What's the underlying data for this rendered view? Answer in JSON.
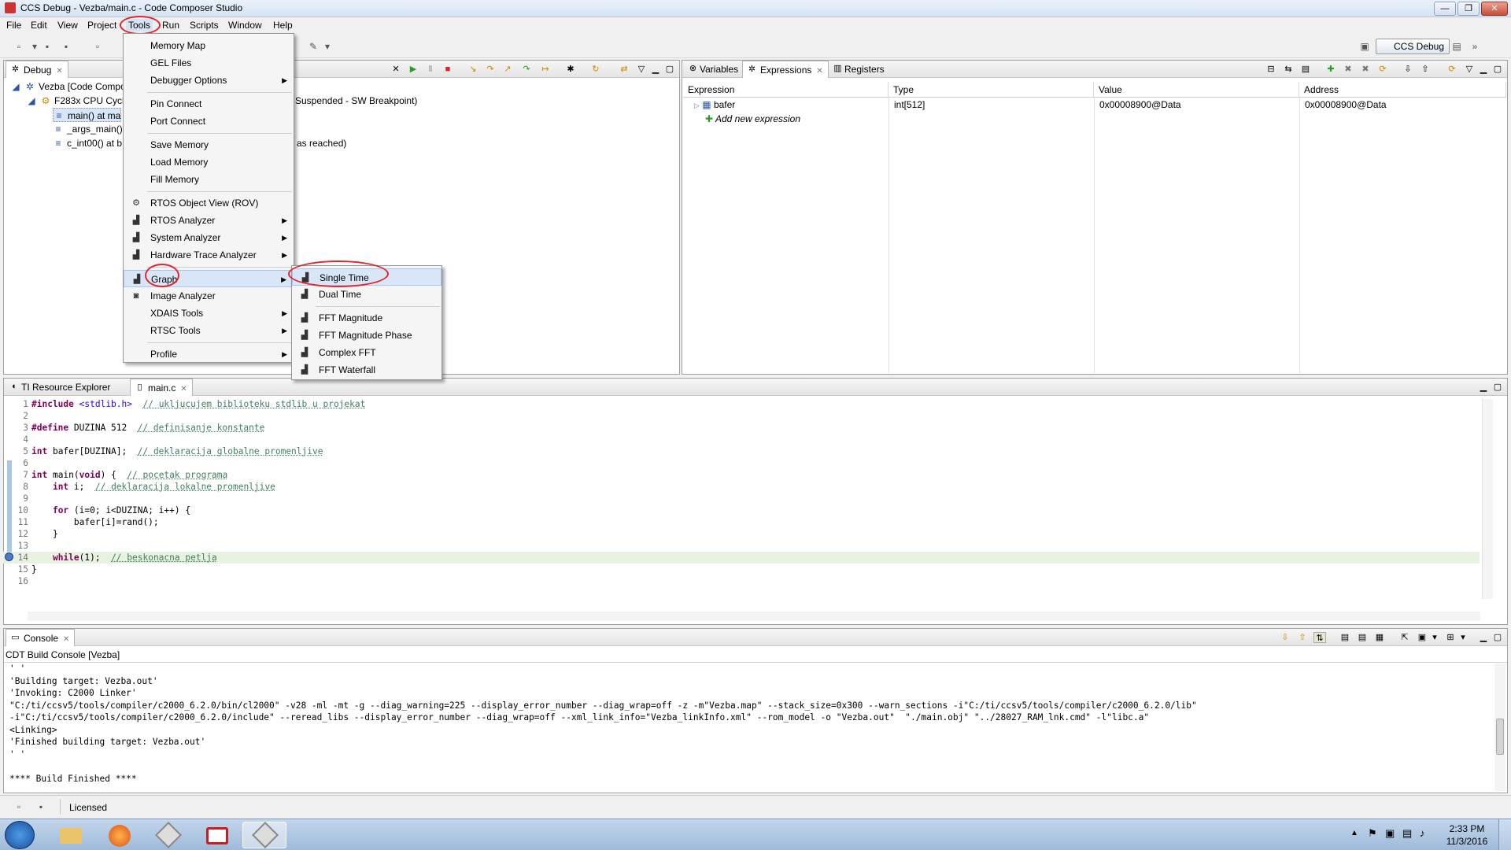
{
  "window": {
    "title": "CCS Debug - Vezba/main.c - Code Composer Studio",
    "controls": [
      "—",
      "❐",
      "✕"
    ]
  },
  "menubar": [
    "File",
    "Edit",
    "View",
    "Project",
    "Tools",
    "Run",
    "Scripts",
    "Window",
    "Help"
  ],
  "toolbar": {
    "perspective_label": "CCS Debug"
  },
  "debug_panel": {
    "tab_label": "Debug",
    "tree": [
      "Vezba [Code Compo",
      "F283x CPU Cycle",
      "main() at ma",
      "_args_main()",
      "c_int00() at b"
    ],
    "partial_texts": [
      "Suspended - SW Breakpoint)",
      "as reached)"
    ]
  },
  "variables_panel": {
    "tabs": [
      "Variables",
      "Expressions",
      "Registers"
    ],
    "columns": [
      "Expression",
      "Type",
      "Value",
      "Address"
    ],
    "rows": [
      {
        "expression": "bafer",
        "type": "int[512]",
        "value": "0x00008900@Data",
        "address": "0x00008900@Data"
      }
    ],
    "add_label": "Add new expression"
  },
  "editor": {
    "tabs": [
      "TI Resource Explorer",
      "main.c"
    ],
    "lines": [
      {
        "n": "1",
        "code": "#include <stdlib.h>  // ukljucujem biblioteku stdlib u projekat"
      },
      {
        "n": "2",
        "code": ""
      },
      {
        "n": "3",
        "code": "#define DUZINA 512  // definisanje konstante"
      },
      {
        "n": "4",
        "code": ""
      },
      {
        "n": "5",
        "code": "int bafer[DUZINA];  // deklaracija globalne promenljive"
      },
      {
        "n": "6",
        "code": ""
      },
      {
        "n": "7",
        "code": "int main(void) {  // pocetak programa"
      },
      {
        "n": "8",
        "code": "    int i;  // deklaracija lokalne promenljive"
      },
      {
        "n": "9",
        "code": ""
      },
      {
        "n": "10",
        "code": "    for (i=0; i<DUZINA; i++) {"
      },
      {
        "n": "11",
        "code": "        bafer[i]=rand();"
      },
      {
        "n": "12",
        "code": "    }"
      },
      {
        "n": "13",
        "code": ""
      },
      {
        "n": "14",
        "code": "    while(1);  // beskonacna petlja"
      },
      {
        "n": "15",
        "code": "}"
      },
      {
        "n": "16",
        "code": ""
      }
    ]
  },
  "console": {
    "tab_label": "Console",
    "subtitle": "CDT Build Console [Vezba]",
    "lines": [
      "' '",
      "'Building target: Vezba.out'",
      "'Invoking: C2000 Linker'",
      "\"C:/ti/ccsv5/tools/compiler/c2000_6.2.0/bin/cl2000\" -v28 -ml -mt -g --diag_warning=225 --display_error_number --diag_wrap=off -z -m\"Vezba.map\" --stack_size=0x300 --warn_sections -i\"C:/ti/ccsv5/tools/compiler/c2000_6.2.0/lib\"",
      "-i\"C:/ti/ccsv5/tools/compiler/c2000_6.2.0/include\" --reread_libs --display_error_number --diag_wrap=off --xml_link_info=\"Vezba_linkInfo.xml\" --rom_model -o \"Vezba.out\"  \"./main.obj\" \"../28027_RAM_lnk.cmd\" -l\"libc.a\"",
      "<Linking>",
      "'Finished building target: Vezba.out'",
      "' '",
      "",
      "**** Build Finished ****"
    ]
  },
  "tools_menu": {
    "groups": [
      [
        "Memory Map",
        "GEL Files",
        "Debugger Options"
      ],
      [
        "Pin Connect",
        "Port Connect"
      ],
      [
        "Save Memory",
        "Load Memory",
        "Fill Memory"
      ],
      [
        "RTOS Object View (ROV)",
        "RTOS Analyzer",
        "System Analyzer",
        "Hardware Trace Analyzer"
      ],
      [
        "Graph",
        "Image Analyzer",
        "XDAIS Tools",
        "RTSC Tools"
      ],
      [
        "Profile"
      ]
    ]
  },
  "graph_submenu": [
    "Single Time",
    "Dual Time",
    "FFT Magnitude",
    "FFT Magnitude Phase",
    "Complex FFT",
    "FFT Waterfall"
  ],
  "statusbar": {
    "license": "Licensed"
  },
  "taskbar": {
    "time": "2:33 PM",
    "date": "11/3/2016"
  },
  "colors": {
    "highlight_ellipse": "#e0262c",
    "current_line": "#e8f2e0"
  }
}
